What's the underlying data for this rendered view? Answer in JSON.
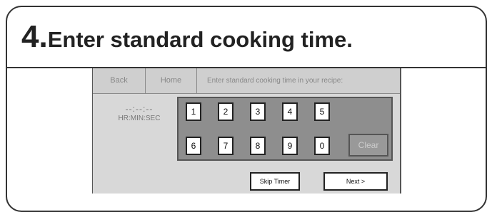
{
  "step": {
    "number": "4.",
    "text": "Enter standard cooking time."
  },
  "nav": {
    "back_label": "Back",
    "home_label": "Home"
  },
  "prompt": "Enter standard cooking time in your recipe:",
  "display": {
    "value": "--:--:--",
    "unit": "HR:MIN:SEC"
  },
  "keypad": {
    "row1": [
      "1",
      "2",
      "3",
      "4",
      "5"
    ],
    "row2": [
      "6",
      "7",
      "8",
      "9",
      "0"
    ],
    "clear_label": "Clear"
  },
  "actions": {
    "skip_label": "Skip Timer",
    "next_label": "Next >"
  }
}
